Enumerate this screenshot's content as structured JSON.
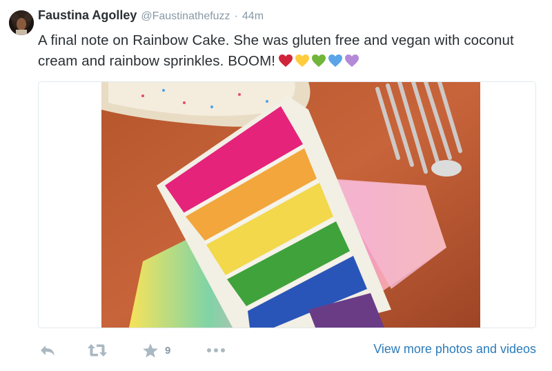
{
  "tweet": {
    "fullname": "Faustina Agolley",
    "username": "@Faustinathefuzz",
    "separator": "·",
    "time": "44m",
    "text": "A final note on Rainbow Cake. She was gluten free and vegan with coconut cream and rainbow sprinkles. BOOM!",
    "hearts": [
      {
        "icon": "red-heart-icon",
        "color": "#d0243a"
      },
      {
        "icon": "yellow-heart-icon",
        "color": "#ffcc3e"
      },
      {
        "icon": "green-heart-icon",
        "color": "#72b53b"
      },
      {
        "icon": "blue-heart-icon",
        "color": "#5aa5e8"
      },
      {
        "icon": "purple-heart-icon",
        "color": "#b48ad8"
      }
    ]
  },
  "media": {
    "description_icon": "rainbow-cake-photo"
  },
  "actions": {
    "reply_icon": "reply-icon",
    "retweet_icon": "retweet-icon",
    "favorite_icon": "star-icon",
    "favorite_count": "9",
    "more_icon": "more-dots-icon",
    "view_more_label": "View more photos and videos"
  },
  "colors": {
    "link": "#2b7bb9",
    "muted": "#8899a6",
    "icon": "#aab8c2",
    "border": "#e1e8ed"
  }
}
